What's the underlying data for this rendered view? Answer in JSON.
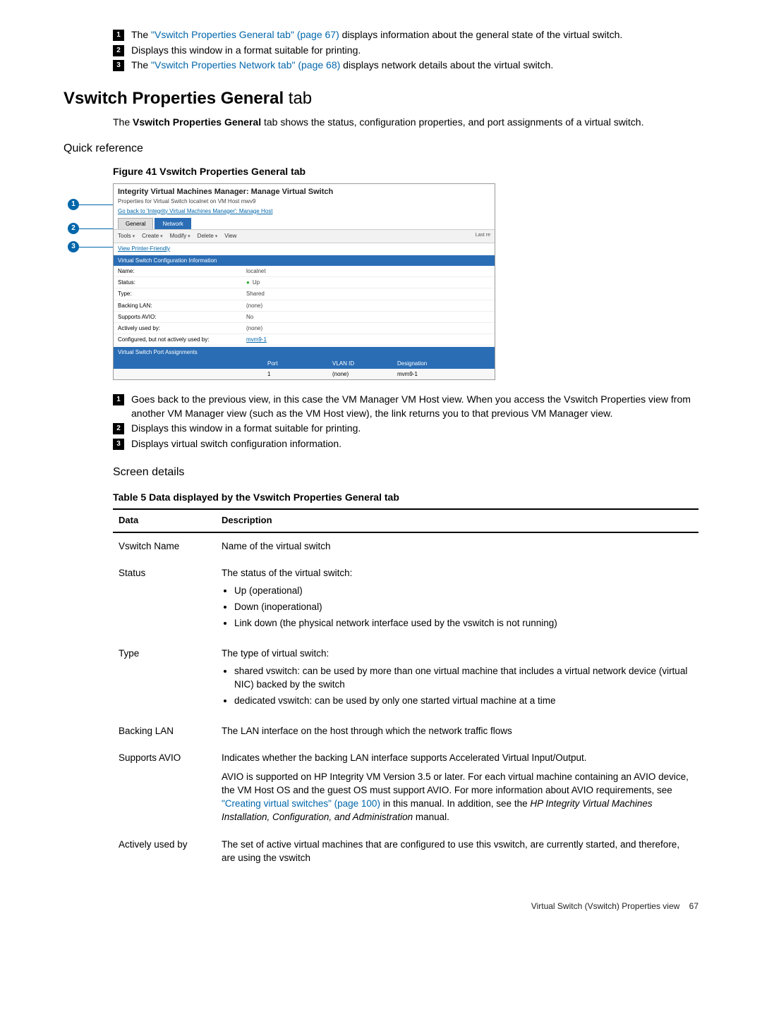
{
  "callouts_top": [
    {
      "n": "1",
      "pre": "The ",
      "link": "\"Vswitch Properties General tab\" (page 67)",
      "post": " displays information about the general state of the virtual switch."
    },
    {
      "n": "2",
      "pre": "",
      "link": "",
      "post": "Displays this window in a format suitable for printing."
    },
    {
      "n": "3",
      "pre": "The ",
      "link": "\"Vswitch Properties Network tab\" (page 68)",
      "post": " displays network details about the virtual switch."
    }
  ],
  "h2_bold": "Vswitch Properties General",
  "h2_rest": " tab",
  "intro_pre": "The ",
  "intro_bold": "Vswitch Properties General",
  "intro_post": " tab shows the status, configuration properties, and port assignments of a virtual switch.",
  "quickref": "Quick reference",
  "fig_caption": "Figure 41 Vswitch Properties General tab",
  "ss": {
    "title": "Integrity Virtual Machines Manager: Manage Virtual Switch",
    "sub": "Properties for Virtual Switch localnet on VM Host mwv9",
    "back": "Go back to 'Integrity Virtual Machines Manager': Manage Host",
    "tab_general": "General",
    "tab_network": "Network",
    "tools": "Tools",
    "create": "Create",
    "modify": "Modify",
    "delete": "Delete",
    "view": "View",
    "last": "Last re",
    "pf": "View Printer-Friendly",
    "sect1": "Virtual Switch Configuration Information",
    "rows": [
      {
        "k": "Name:",
        "v": "localnet"
      },
      {
        "k": "Status:",
        "v": "Up",
        "up": true
      },
      {
        "k": "Type:",
        "v": "Shared"
      },
      {
        "k": "Backing LAN:",
        "v": "(none)"
      },
      {
        "k": "Supports AVIO:",
        "v": "No"
      },
      {
        "k": "Actively used by:",
        "v": "(none)"
      },
      {
        "k": "Configured, but not actively used by:",
        "v": "mvm9-1",
        "link": true
      }
    ],
    "sect2": "Virtual Switch Port Assignments",
    "porthead": {
      "c1": "",
      "c2": "Port",
      "c3": "VLAN ID",
      "c4": "Designation"
    },
    "portrow": {
      "c1": "",
      "c2": "1",
      "c3": "(none)",
      "c4": "mvm9-1"
    }
  },
  "callouts_mid": [
    {
      "n": "1",
      "text": "Goes back to the previous view, in this case the VM Manager VM Host view. When you access the Vswitch Properties view from another VM Manager view (such as the VM Host view), the link returns you to that previous VM Manager view."
    },
    {
      "n": "2",
      "text": "Displays this window in a format suitable for printing."
    },
    {
      "n": "3",
      "text": "Displays virtual switch configuration information."
    }
  ],
  "screen_details": "Screen details",
  "table_caption": "Table 5 Data displayed by the Vswitch Properties General tab",
  "th_data": "Data",
  "th_desc": "Description",
  "rows": {
    "vswitch_name": {
      "k": "Vswitch Name",
      "v": "Name of the virtual switch"
    },
    "status": {
      "k": "Status",
      "lead": "The status of the virtual switch:",
      "items": [
        "Up (operational)",
        "Down (inoperational)",
        "Link down (the physical network interface used by the vswitch is not running)"
      ]
    },
    "type": {
      "k": "Type",
      "lead": "The type of virtual switch:",
      "items": [
        "shared vswitch: can be used by more than one virtual machine that includes a virtual network device (virtual NIC) backed by the switch",
        "dedicated vswitch: can be used by only one started virtual machine at a time"
      ]
    },
    "backing": {
      "k": "Backing LAN",
      "v": "The LAN interface on the host through which the network traffic flows"
    },
    "avio": {
      "k": "Supports AVIO",
      "p1": "Indicates whether the backing LAN interface supports Accelerated Virtual Input/Output.",
      "p2a": "AVIO is supported on HP Integrity VM Version 3.5 or later. For each virtual machine containing an AVIO device, the VM Host OS and the guest OS must support AVIO. For more information about AVIO requirements, see ",
      "p2link": "\"Creating virtual switches\" (page 100)",
      "p2b": " in this manual. In addition, see the ",
      "p2i": "HP Integrity Virtual Machines Installation, Configuration, and Administration",
      "p2c": " manual."
    },
    "actively": {
      "k": "Actively used by",
      "v": "The set of active virtual machines that are configured to use this vswitch, are currently started, and therefore, are using the vswitch"
    }
  },
  "footer_text": "Virtual Switch (Vswitch) Properties view",
  "footer_page": "67"
}
